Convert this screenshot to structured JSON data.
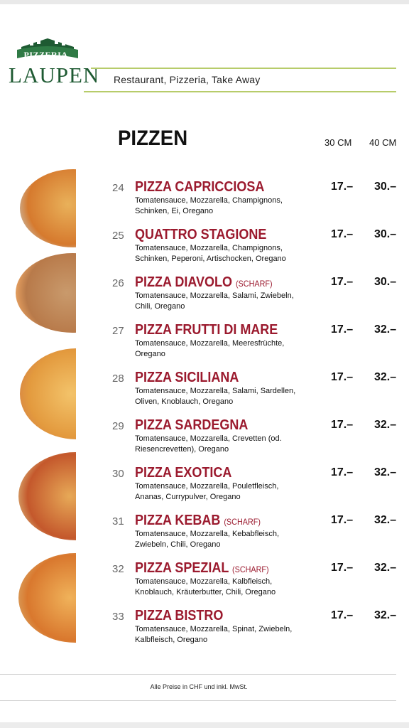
{
  "header": {
    "logo_top": "PIZZERIA",
    "logo_main": "LAUPEN",
    "tagline": "Restaurant, Pizzeria, Take Away"
  },
  "section": {
    "title": "PIZZEN",
    "col_small": "30 CM",
    "col_large": "40 CM"
  },
  "colors": {
    "accent_red": "#9b1a2e",
    "logo_green": "#1e5a32",
    "rule_green": "#b7cc6a"
  },
  "items": [
    {
      "number": "24",
      "name": "PIZZA CAPRICCIOSA",
      "tag": "",
      "desc": "Tomatensauce, Mozzarella, Champignons, Schinken, Ei, Oregano",
      "price30": "17.–",
      "price40": "30.–"
    },
    {
      "number": "25",
      "name": "QUATTRO STAGIONE",
      "tag": "",
      "desc": "Tomatensauce, Mozzarella, Champignons, Schinken, Peperoni, Artischocken, Oregano",
      "price30": "17.–",
      "price40": "30.–"
    },
    {
      "number": "26",
      "name": "PIZZA DIAVOLO",
      "tag": "(SCHARF)",
      "desc": "Tomatensauce, Mozzarella, Salami, Zwiebeln, Chili, Oregano",
      "price30": "17.–",
      "price40": "30.–"
    },
    {
      "number": "27",
      "name": "PIZZA FRUTTI DI MARE",
      "tag": "",
      "desc": "Tomatensauce, Mozzarella, Meeresfrüchte, Oregano",
      "price30": "17.–",
      "price40": "32.–"
    },
    {
      "number": "28",
      "name": "PIZZA SICILIANA",
      "tag": "",
      "desc": "Tomatensauce, Mozzarella, Salami, Sardellen, Oliven, Knoblauch, Oregano",
      "price30": "17.–",
      "price40": "32.–"
    },
    {
      "number": "29",
      "name": "PIZZA SARDEGNA",
      "tag": "",
      "desc": "Tomatensauce, Mozzarella, Crevetten (od. Riesencrevetten), Oregano",
      "price30": "17.–",
      "price40": "32.–"
    },
    {
      "number": "30",
      "name": "PIZZA EXOTICA",
      "tag": "",
      "desc": "Tomatensauce, Mozzarella, Pouletfleisch, Ananas, Currypulver, Oregano",
      "price30": "17.–",
      "price40": "32.–"
    },
    {
      "number": "31",
      "name": "PIZZA KEBAB",
      "tag": "(SCHARF)",
      "desc": "Tomatensauce, Mozzarella, Kebabfleisch, Zwiebeln, Chili, Oregano",
      "price30": "17.–",
      "price40": "32.–"
    },
    {
      "number": "32",
      "name": "PIZZA SPEZIAL",
      "tag": "(SCHARF)",
      "desc": "Tomatensauce, Mozzarella, Kalbfleisch, Knoblauch, Kräuterbutter, Chili, Oregano",
      "price30": "17.–",
      "price40": "32.–"
    },
    {
      "number": "33",
      "name": "PIZZA BISTRO",
      "tag": "",
      "desc": "Tomatensauce, Mozzarella, Spinat, Zwiebeln, Kalbfleisch, Oregano",
      "price30": "17.–",
      "price40": "32.–"
    }
  ],
  "footer": {
    "note": "Alle Preise in CHF und inkl. MwSt."
  }
}
